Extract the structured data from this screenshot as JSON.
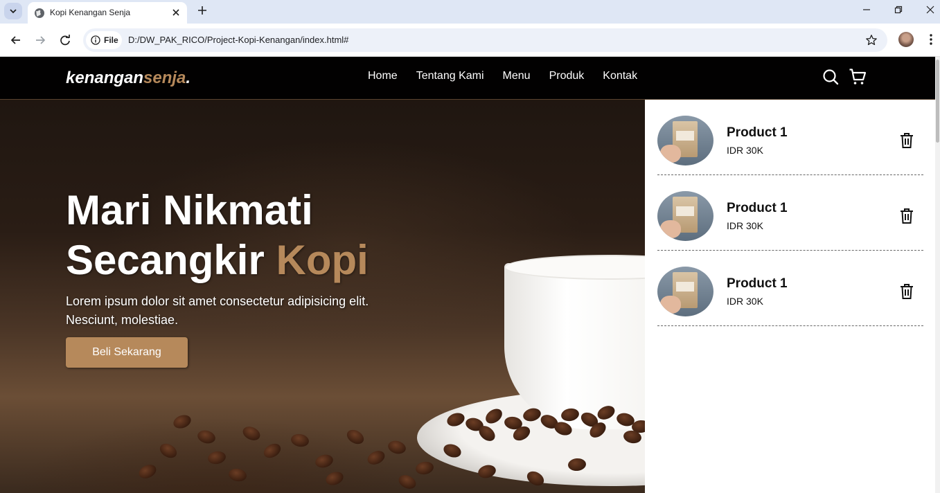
{
  "browser": {
    "tab_title": "Kopi Kenangan Senja",
    "site_chip_label": "File",
    "url": "D:/DW_PAK_RICO/Project-Kopi-Kenangan/index.html#"
  },
  "site": {
    "logo_main": "kenangan",
    "logo_accent": "senja",
    "logo_dot": ".",
    "nav_links": [
      "Home",
      "Tentang Kami",
      "Menu",
      "Produk",
      "Kontak"
    ],
    "accent_color": "#b6895b"
  },
  "hero": {
    "title_line1": "Mari Nikmati",
    "title_line2_main": "Secangkir ",
    "title_line2_accent": "Kopi",
    "description": "Lorem ipsum dolor sit amet consectetur adipisicing elit. Nesciunt, molestiae.",
    "cta_label": "Beli Sekarang"
  },
  "cart": {
    "items": [
      {
        "name": "Product 1",
        "price": "IDR 30K"
      },
      {
        "name": "Product 1",
        "price": "IDR 30K"
      },
      {
        "name": "Product 1",
        "price": "IDR 30K"
      }
    ]
  }
}
